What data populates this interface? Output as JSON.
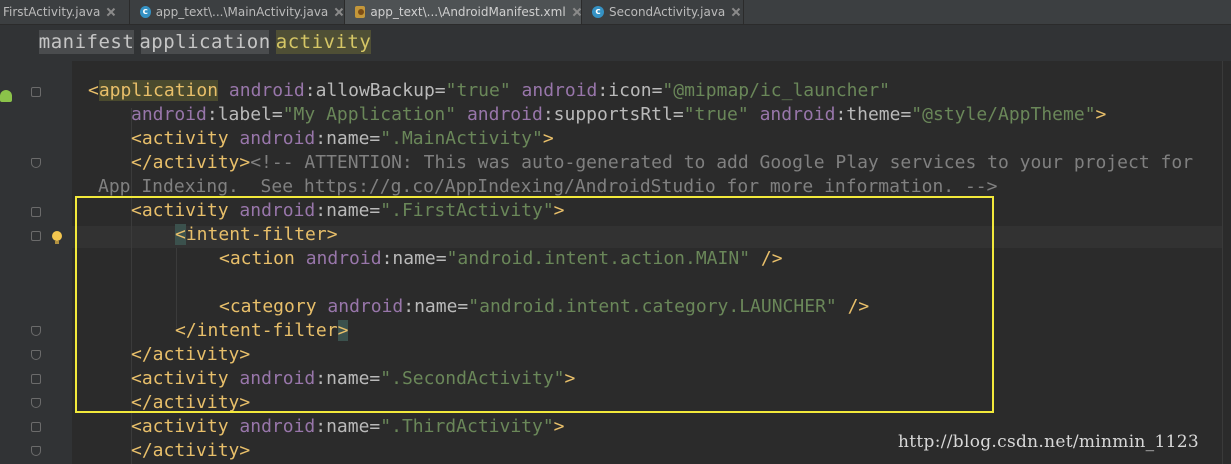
{
  "tabs": [
    {
      "label": "FirstActivity.java",
      "icon": "java-class-icon",
      "active": false
    },
    {
      "label": "app_text\\...\\MainActivity.java",
      "icon": "java-class-icon",
      "active": false
    },
    {
      "label": "app_text\\...\\AndroidManifest.xml",
      "icon": "xml-file-icon",
      "active": true
    },
    {
      "label": "SecondActivity.java",
      "icon": "java-class-icon",
      "active": false
    }
  ],
  "breadcrumb": [
    "manifest",
    "application",
    "activity"
  ],
  "code": {
    "l1": {
      "open": "<",
      "tag": "application",
      "a1ns": "android",
      "a1": ":allowBackup=",
      "v1": "\"true\"",
      "a2ns": "android",
      "a2": ":icon=",
      "v2": "\"@mipmap/ic_launcher\""
    },
    "l2": {
      "a1ns": "android",
      "a1": ":label=",
      "v1": "\"My Application\"",
      "a2ns": "android",
      "a2": ":supportsRtl=",
      "v2": "\"true\"",
      "a3ns": "android",
      "a3": ":theme=",
      "v3": "\"@style/AppTheme\"",
      "close": ">"
    },
    "l3": {
      "tag": "<activity",
      "ans": "android",
      "a": ":name=",
      "v": "\".MainActivity\"",
      "close": ">"
    },
    "l4": {
      "tag": "</activity>",
      "comment": "<!-- ATTENTION: This was auto-generated to add Google Play services to your project for"
    },
    "l5": {
      "comment": "App Indexing.  See https://g.co/AppIndexing/AndroidStudio for more information. -->"
    },
    "l6": {
      "tag": "<activity",
      "ans": "android",
      "a": ":name=",
      "v": "\".FirstActivity\"",
      "close": ">"
    },
    "l7": {
      "open": "<",
      "tag": "intent-filter>"
    },
    "l8": {
      "tag": "<action",
      "ans": "android",
      "a": ":name=",
      "v": "\"android.intent.action.MAIN\"",
      "close": " />"
    },
    "l9": {
      "tag": "<category",
      "ans": "android",
      "a": ":name=",
      "v": "\"android.intent.category.LAUNCHER\"",
      "close": " />"
    },
    "l10": {
      "tag": "</intent-filter",
      "close": ">"
    },
    "l11": {
      "tag": "</activity>"
    },
    "l12": {
      "tag": "<activity",
      "ans": "android",
      "a": ":name=",
      "v": "\".SecondActivity\"",
      "close": ">"
    },
    "l13": {
      "tag": "</activity>"
    },
    "l14": {
      "tag": "<activity",
      "ans": "android",
      "a": ":name=",
      "v": "\".ThirdActivity\"",
      "close": ">"
    },
    "l15": {
      "tag": "</activity>"
    }
  },
  "watermark": "http://blog.csdn.net/minmin_1123",
  "colors": {
    "tag": "#e8bf6a",
    "namespace": "#9876aa",
    "value": "#6a8759",
    "comment": "#808080",
    "highlight_box": "#f2e93b"
  }
}
